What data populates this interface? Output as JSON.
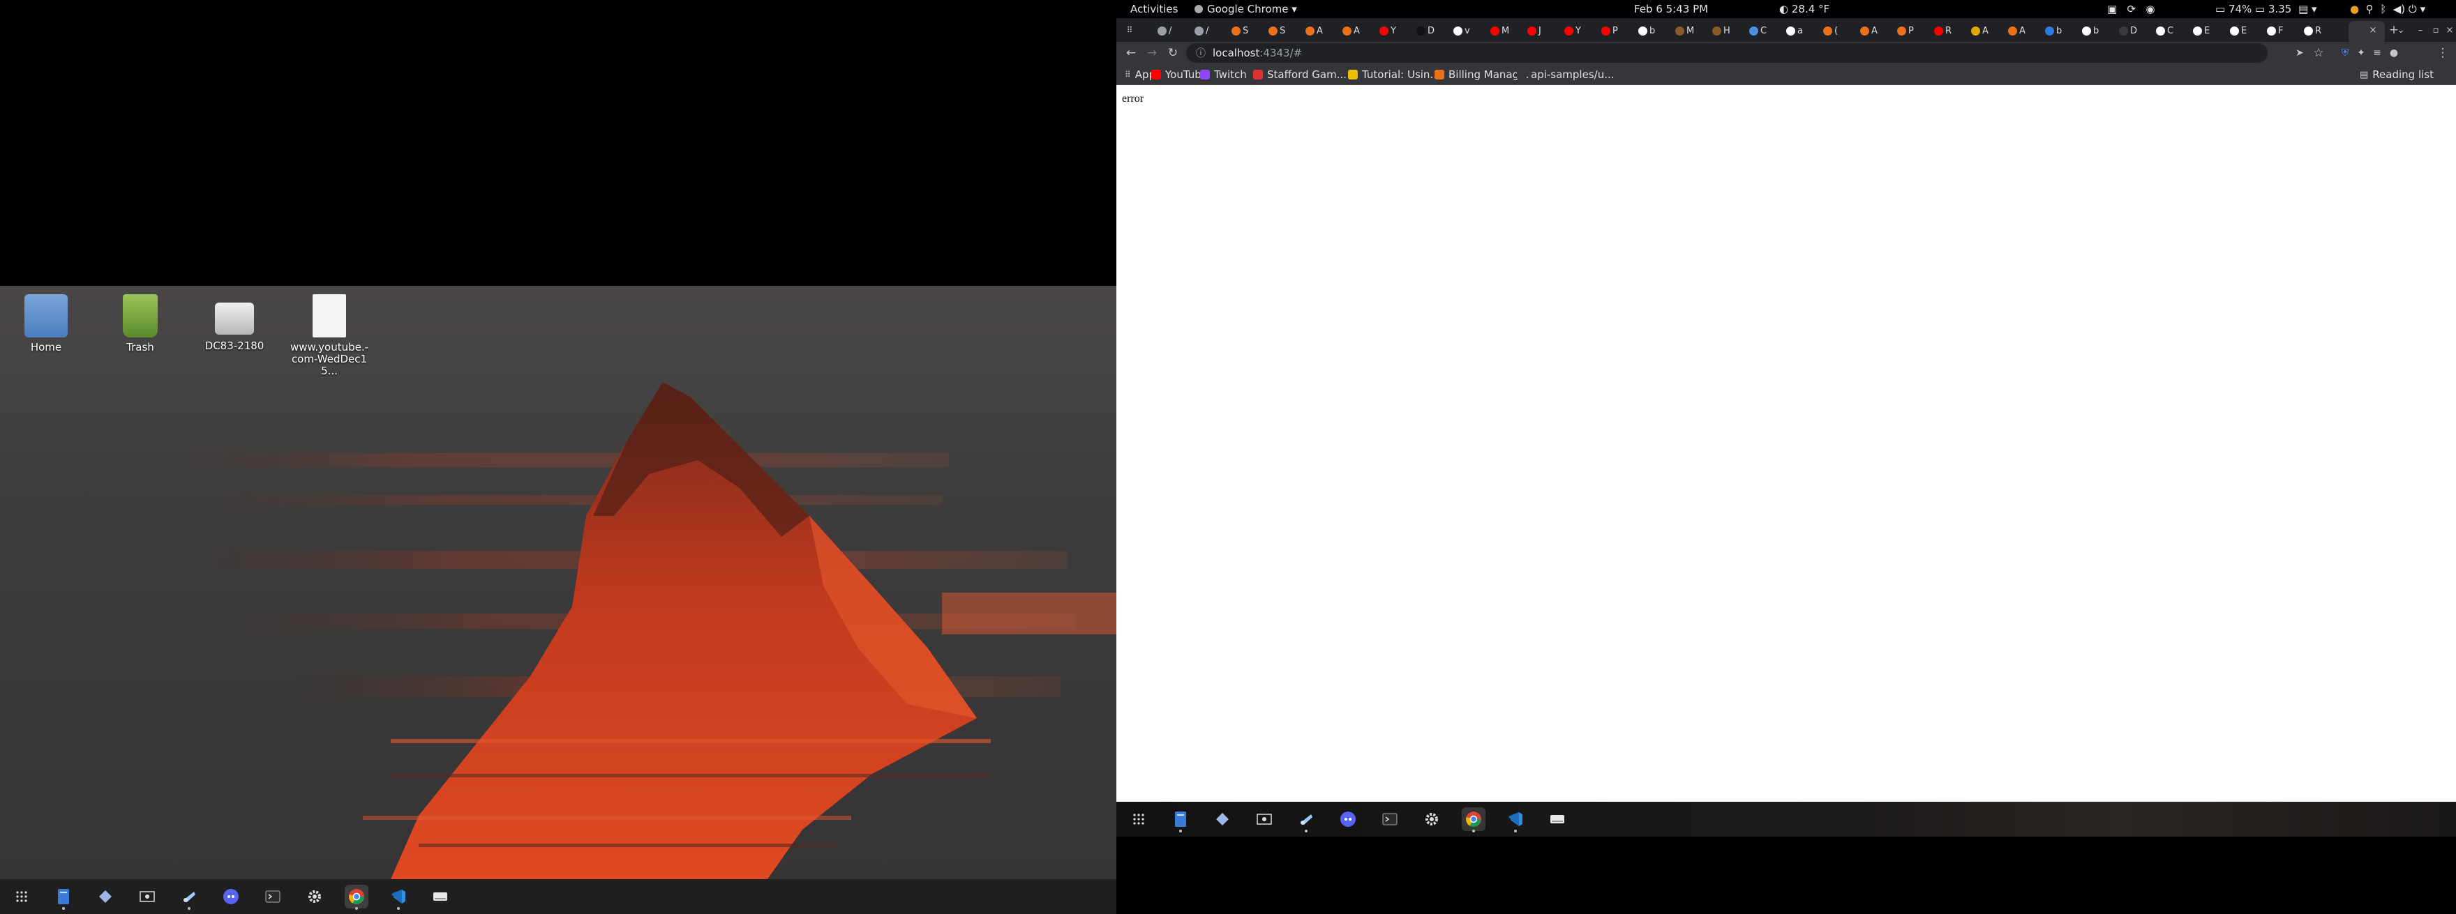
{
  "topbar": {
    "activities": "Activities",
    "app_menu": "Google Chrome",
    "clock": "Feb 6  5:43 PM",
    "weather": "28.4 °F",
    "battery": "74%",
    "cpu": "3.35"
  },
  "desktop": {
    "icons": [
      {
        "label": "Home"
      },
      {
        "label": "Trash"
      },
      {
        "label": "DC83-2180"
      },
      {
        "label": "www.youtube.-com-WedDec15..."
      }
    ]
  },
  "browser": {
    "tabs": [
      {
        "text": "/",
        "color": "#9aa0a6"
      },
      {
        "text": "/",
        "color": "#9aa0a6"
      },
      {
        "text": "S",
        "color": "#e8711a"
      },
      {
        "text": "S",
        "color": "#e8711a"
      },
      {
        "text": "A",
        "color": "#e8711a"
      },
      {
        "text": "A",
        "color": "#e8711a"
      },
      {
        "text": "Y",
        "color": "#ff0000"
      },
      {
        "text": "D",
        "color": "#111111"
      },
      {
        "text": "v",
        "color": "#ffffff"
      },
      {
        "text": "M",
        "color": "#ff0000"
      },
      {
        "text": "J",
        "color": "#ff0000"
      },
      {
        "text": "Y",
        "color": "#ff0000"
      },
      {
        "text": "P",
        "color": "#ff0000"
      },
      {
        "text": "b",
        "color": "#ffffff"
      },
      {
        "text": "M",
        "color": "#8a5a2b"
      },
      {
        "text": "H",
        "color": "#8a5a2b"
      },
      {
        "text": "C",
        "color": "#4a90e2"
      },
      {
        "text": "a",
        "color": "#ffffff"
      },
      {
        "text": "(",
        "color": "#e8711a"
      },
      {
        "text": "A",
        "color": "#e8711a"
      },
      {
        "text": "P",
        "color": "#e8711a"
      },
      {
        "text": "R",
        "color": "#ff0000"
      },
      {
        "text": "A",
        "color": "#e0a800"
      },
      {
        "text": "A",
        "color": "#e8711a"
      },
      {
        "text": "b",
        "color": "#2c7be5"
      },
      {
        "text": "b",
        "color": "#ffffff"
      },
      {
        "text": "D",
        "color": "#3a3a3a"
      },
      {
        "text": "C",
        "color": "#ffffff"
      },
      {
        "text": "E",
        "color": "#ffffff"
      },
      {
        "text": "E",
        "color": "#ffffff"
      },
      {
        "text": "F",
        "color": "#ffffff"
      },
      {
        "text": "R",
        "color": "#ffffff"
      }
    ],
    "address": {
      "host": "localhost",
      "path": ":4343/#"
    },
    "bookmarks": {
      "apps": "Apps",
      "items": [
        {
          "label": "YouTube",
          "color": "#ff0000"
        },
        {
          "label": "Twitch",
          "color": "#9146ff"
        },
        {
          "label": "Stafford Gam...",
          "color": "#e03030"
        },
        {
          "label": "Tutorial: Usin...",
          "color": "#e8c000"
        },
        {
          "label": "Billing Manag...",
          "color": "#e8711a"
        },
        {
          "label": "api-samples/u...",
          "color": "#35363a"
        }
      ],
      "reading_list": "Reading list"
    },
    "page": {
      "body_text": "error"
    }
  },
  "dock": {
    "items": [
      "app-grid-icon",
      "files-icon",
      "diamond-app-icon",
      "screenshot-icon",
      "steam-icon",
      "discord-icon",
      "terminal-icon",
      "settings-icon",
      "chrome-icon",
      "vscode-icon",
      "drive-icon"
    ]
  },
  "colors": {
    "accent": "#e8711a",
    "page_bg": "#ffffff",
    "chrome_dark": "#35363a"
  }
}
